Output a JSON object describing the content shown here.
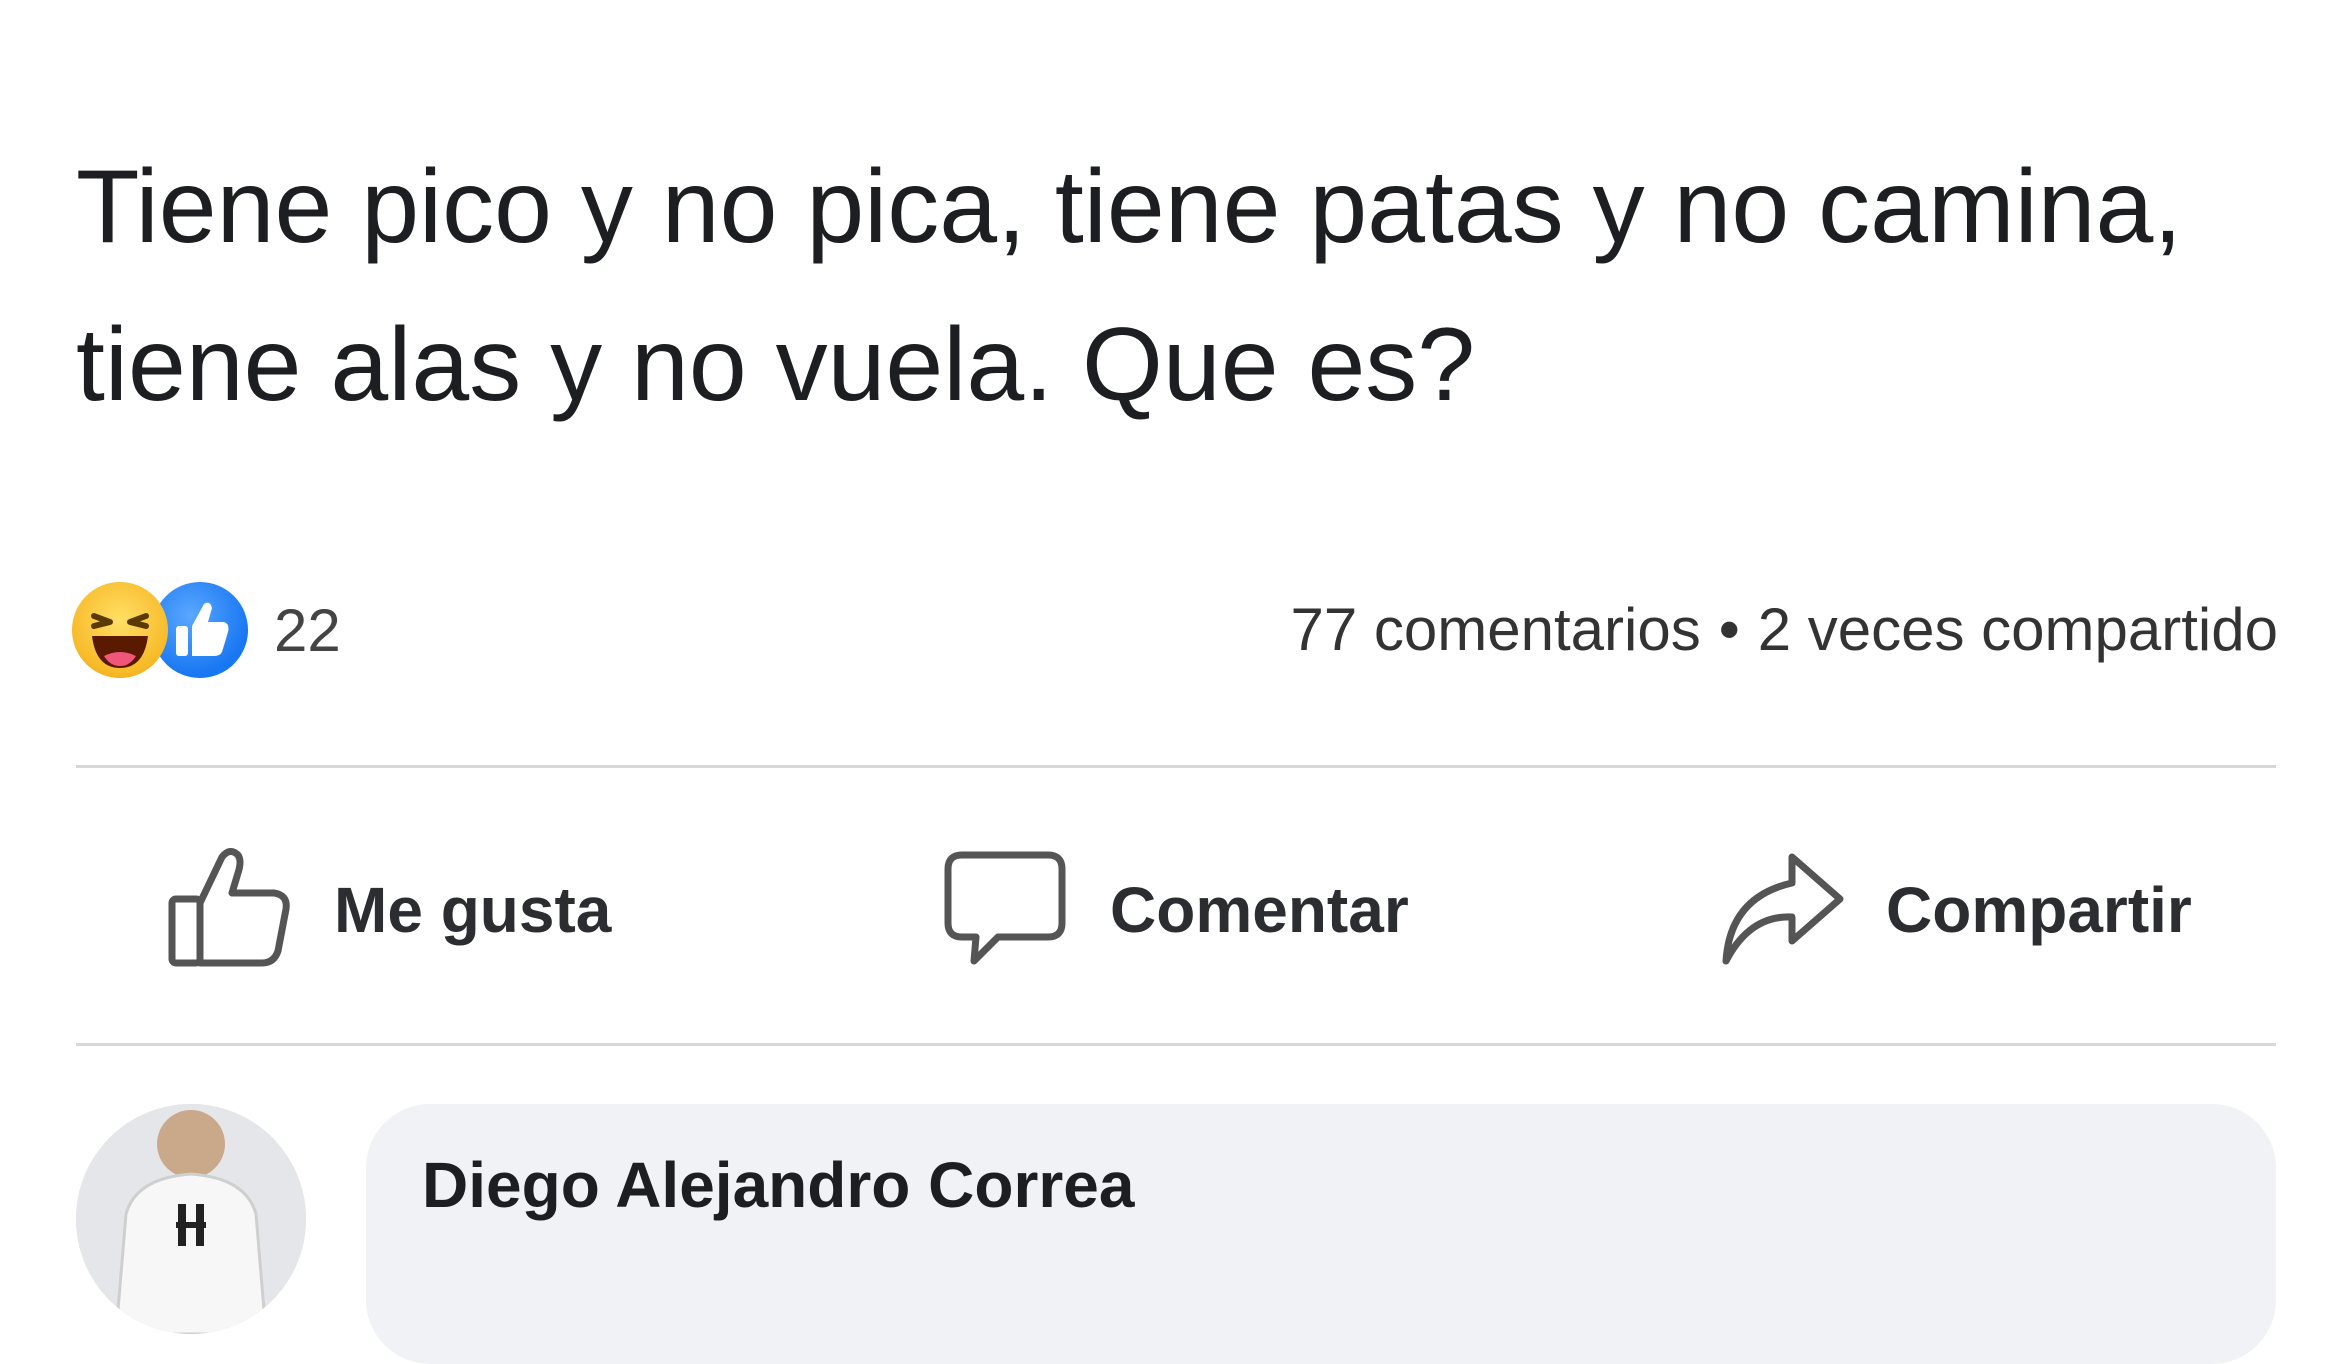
{
  "post": {
    "text": "Tiene pico y no pica, tiene patas y no camina, tiene alas y no vuela. Que es?"
  },
  "reactions": {
    "icons": [
      "haha-icon",
      "like-icon"
    ],
    "count": "22",
    "comments_label": "77 comentarios",
    "separator": "•",
    "shares_label": "2 veces compartido"
  },
  "actions": {
    "like_label": "Me gusta",
    "comment_label": "Comentar",
    "share_label": "Compartir"
  },
  "comment": {
    "author": "Diego Alejandro Correa"
  },
  "colors": {
    "like_blue": "#1877f2",
    "haha_yellow": "#f7b928",
    "bubble_bg": "#f0f2f5",
    "divider": "#d6d8dc"
  }
}
